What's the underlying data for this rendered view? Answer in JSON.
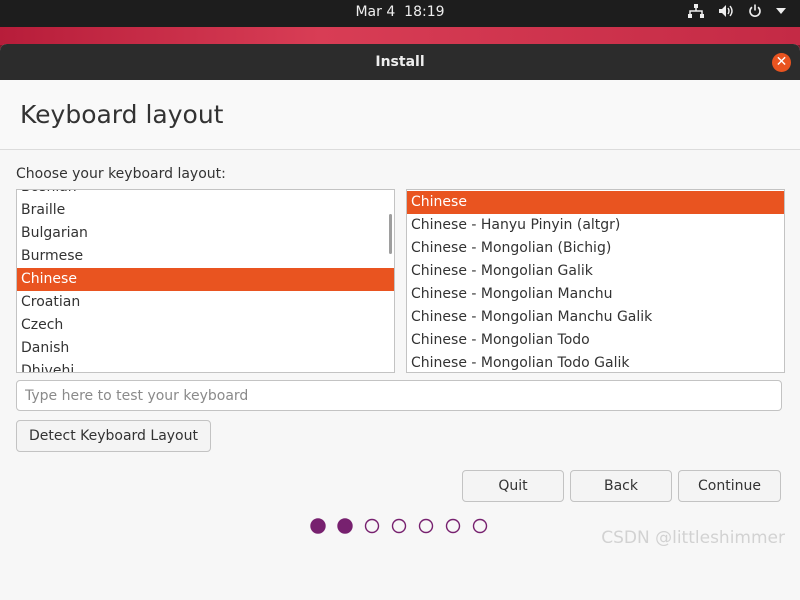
{
  "topbar": {
    "date": "Mar 4",
    "time": "18:19",
    "icons": [
      "network-icon",
      "volume-icon",
      "power-icon",
      "chevron-down-icon"
    ]
  },
  "window": {
    "title": "Install",
    "close_icon": "close-icon"
  },
  "page": {
    "title": "Keyboard layout",
    "choose_label": "Choose your keyboard layout:"
  },
  "layouts": {
    "items": [
      "Bosnian",
      "Braille",
      "Bulgarian",
      "Burmese",
      "Chinese",
      "Croatian",
      "Czech",
      "Danish",
      "Dhivehi"
    ],
    "selected": "Chinese"
  },
  "variants": {
    "items": [
      "Chinese",
      "Chinese - Hanyu Pinyin (altgr)",
      "Chinese - Mongolian (Bichig)",
      "Chinese - Mongolian Galik",
      "Chinese - Mongolian Manchu",
      "Chinese - Mongolian Manchu Galik",
      "Chinese - Mongolian Todo",
      "Chinese - Mongolian Todo Galik"
    ],
    "selected": "Chinese"
  },
  "test_input": {
    "placeholder": "Type here to test your keyboard",
    "value": ""
  },
  "buttons": {
    "detect": "Detect Keyboard Layout",
    "quit": "Quit",
    "back": "Back",
    "continue": "Continue"
  },
  "progress": {
    "total_steps": 7,
    "completed_steps": 2
  },
  "watermark": "CSDN @littleshimmer",
  "colors": {
    "accent": "#e95420",
    "progress_dot": "#77216f",
    "titlebar": "#2c2c2c",
    "topbar": "#1d1d1d"
  }
}
